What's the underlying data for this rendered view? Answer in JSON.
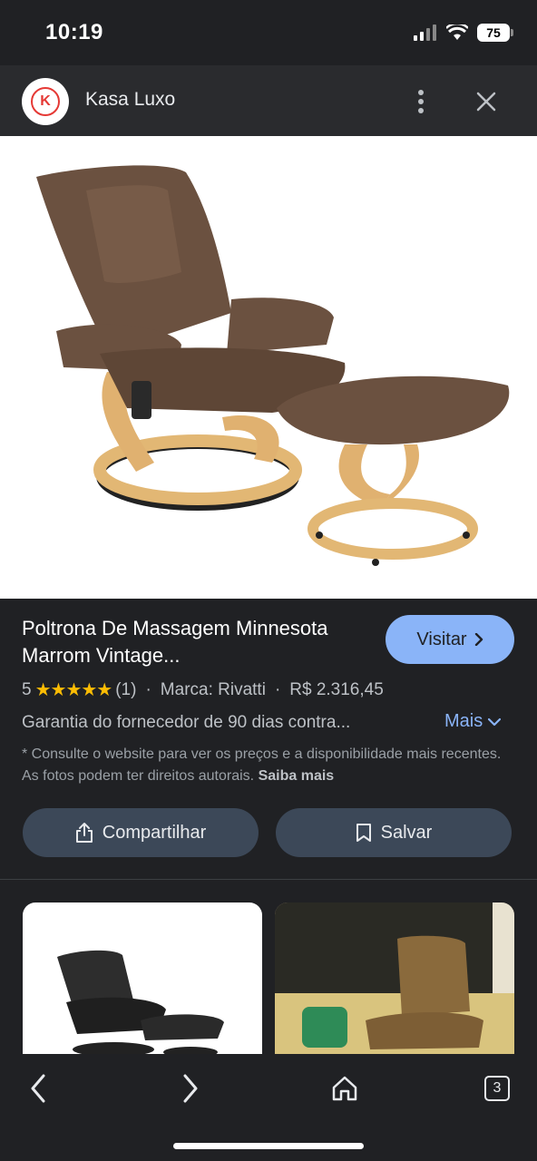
{
  "status": {
    "time": "10:19",
    "battery": "75"
  },
  "header": {
    "site_name": "Kasa Luxo",
    "logo_letter": "K"
  },
  "product": {
    "title": "Poltrona De Massagem Minnesota Marrom Vintage...",
    "visit_label": "Visitar",
    "rating_value": "5",
    "rating_stars": "★★★★★",
    "review_count": "(1)",
    "brand": "Marca: Rivatti",
    "price": "R$ 2.316,45",
    "warranty": "Garantia do fornecedor de 90 dias contra...",
    "more_label": "Mais",
    "disclaimer": "* Consulte o website para ver os preços e a disponibilidade mais recentes. As fotos podem ter direitos autorais.",
    "learn_more": "Saiba mais"
  },
  "actions": {
    "share_label": "Compartilhar",
    "save_label": "Salvar"
  },
  "toolbar": {
    "tab_count": "3"
  },
  "icons": [
    "k-logo-icon",
    "more-vert-icon",
    "close-icon",
    "chevron-right-icon",
    "chevron-down-icon",
    "share-icon",
    "bookmark-icon",
    "back-icon",
    "forward-icon",
    "home-icon",
    "tabs-icon"
  ],
  "colors": {
    "accent": "#8ab4f8",
    "star": "#fbbc04",
    "button_bg": "#3c4858",
    "background": "#202124"
  }
}
